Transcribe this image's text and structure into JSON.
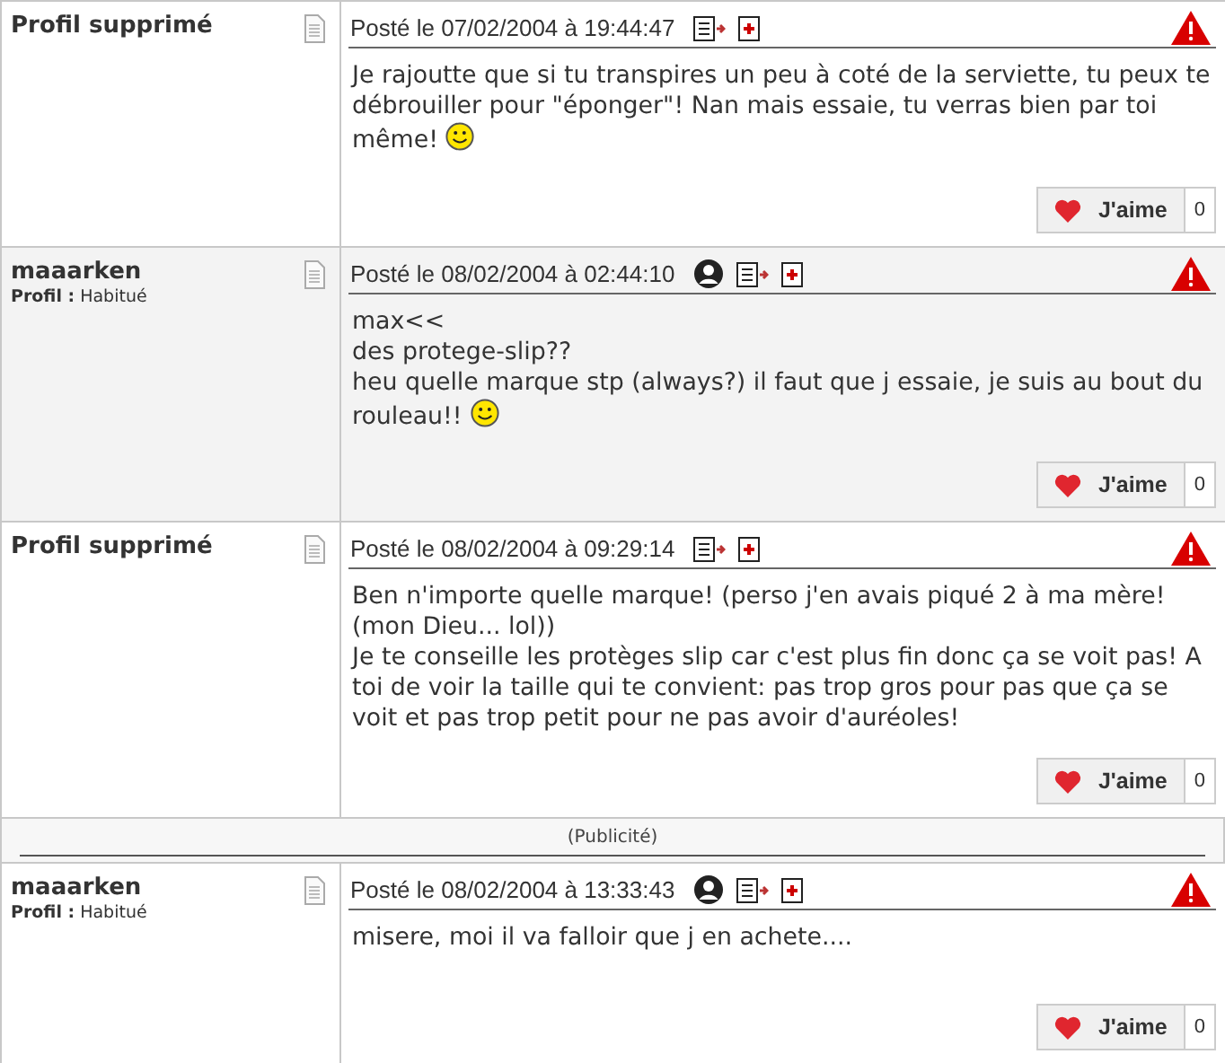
{
  "posts": [
    {
      "author": "Profil supprimé",
      "shaded": false,
      "date": "Posté le 07/02/2004 à 19:44:47",
      "profile_link": false,
      "body": [
        {
          "text": "Je rajoutte que si tu transpires un peu à coté de la serviette, tu peux te débrouiller pour \"éponger\"! Nan mais essaie, tu verras bien par toi",
          "smiley": false
        },
        {
          "text": "même!",
          "smiley": true
        }
      ],
      "like": {
        "label": "J'aime",
        "count": "0"
      }
    },
    {
      "author": "maaarken",
      "profile_label": "Profil :",
      "profile_value": "Habitué",
      "shaded": true,
      "date": "Posté le 08/02/2004 à 02:44:10",
      "profile_link": true,
      "body": [
        {
          "text": "max<<",
          "smiley": false
        },
        {
          "text": "des protege-slip??",
          "smiley": false
        },
        {
          "text": "heu quelle marque stp (always?) il faut que j essaie, je suis au bout du",
          "smiley": false
        },
        {
          "text": "rouleau!!",
          "smiley": true
        }
      ],
      "like": {
        "label": "J'aime",
        "count": "0"
      }
    },
    {
      "author": "Profil supprimé",
      "shaded": false,
      "date": "Posté le 08/02/2004 à 09:29:14",
      "profile_link": false,
      "body": [
        {
          "text": "Ben n'importe quelle marque! (perso j'en avais piqué 2 à ma mère! (mon Dieu... lol))",
          "smiley": false
        },
        {
          "text": "Je te conseille les protèges slip car c'est plus fin donc ça se voit pas! A toi de voir la taille qui te convient: pas trop gros pour pas que ça se voit et pas trop petit pour ne pas avoir d'auréoles!",
          "smiley": false
        }
      ],
      "like": {
        "label": "J'aime",
        "count": "0"
      }
    },
    {
      "kind": "ad",
      "label": "(Publicité)"
    },
    {
      "author": "maaarken",
      "profile_label": "Profil :",
      "profile_value": "Habitué",
      "shaded": false,
      "date": "Posté le 08/02/2004 à 13:33:43",
      "profile_link": true,
      "body": [
        {
          "text": "misere, moi il va falloir que j en achete....",
          "smiley": false
        }
      ],
      "like": {
        "label": "J'aime",
        "count": "0"
      }
    }
  ]
}
